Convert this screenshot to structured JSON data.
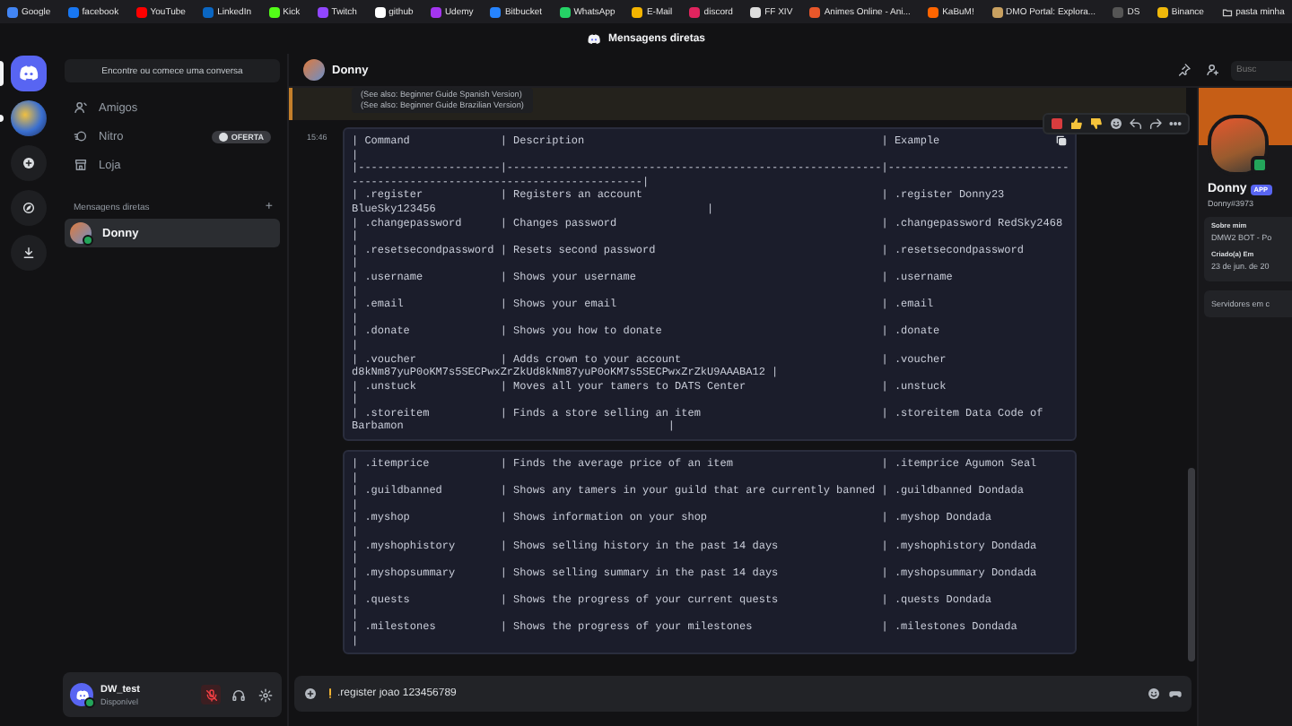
{
  "bookmarks": [
    {
      "kind": "site",
      "label": "Google",
      "color": "#4285f4"
    },
    {
      "kind": "site",
      "label": "facebook",
      "color": "#1877f2"
    },
    {
      "kind": "site",
      "label": "YouTube",
      "color": "#ff0000"
    },
    {
      "kind": "site",
      "label": "LinkedIn",
      "color": "#0a66c2"
    },
    {
      "kind": "site",
      "label": "Kick",
      "color": "#53fc18"
    },
    {
      "kind": "site",
      "label": "Twitch",
      "color": "#9146ff"
    },
    {
      "kind": "site",
      "label": "github",
      "color": "#ffffff"
    },
    {
      "kind": "site",
      "label": "Udemy",
      "color": "#a435f0"
    },
    {
      "kind": "site",
      "label": "Bitbucket",
      "color": "#2684ff"
    },
    {
      "kind": "site",
      "label": "WhatsApp",
      "color": "#25d366"
    },
    {
      "kind": "site",
      "label": "E-Mail",
      "color": "#f4b400"
    },
    {
      "kind": "site",
      "label": "discord",
      "color": "#e0245e"
    },
    {
      "kind": "site",
      "label": "FF XIV",
      "color": "#dddddd"
    },
    {
      "kind": "site",
      "label": "Animes Online - Ani...",
      "color": "#e8572a"
    },
    {
      "kind": "site",
      "label": "KaBuM!",
      "color": "#ff6500"
    },
    {
      "kind": "site",
      "label": "DMO Portal: Explora...",
      "color": "#c8a060"
    },
    {
      "kind": "site",
      "label": "DS",
      "color": "#555555"
    },
    {
      "kind": "site",
      "label": "Binance",
      "color": "#f0b90b"
    },
    {
      "kind": "folder",
      "label": "pasta minha",
      "color": "#cccccc"
    }
  ],
  "window": {
    "title": "Mensagens diretas"
  },
  "server_rail": [
    {
      "kind": "home",
      "selected": true
    },
    {
      "kind": "server",
      "selected": false,
      "unread": true
    },
    {
      "kind": "add",
      "selected": false
    },
    {
      "kind": "explore",
      "selected": false
    },
    {
      "kind": "download",
      "selected": false
    }
  ],
  "sidebar": {
    "search": {
      "placeholder": "Encontre ou comece uma conversa"
    },
    "nav": [
      {
        "kind": "friends",
        "label": "Amigos"
      },
      {
        "kind": "nitro",
        "label": "Nitro",
        "badge": "OFERTA"
      },
      {
        "kind": "shop",
        "label": "Loja"
      }
    ],
    "section_title": "Mensagens diretas",
    "add": "+",
    "dms": [
      {
        "name": "Donny",
        "selected": true
      }
    ]
  },
  "user_panel": {
    "name": "DW_test",
    "status": "Disponível",
    "muted": true
  },
  "chat": {
    "header": {
      "name": "Donny",
      "search": {
        "placeholder": "Busc"
      }
    },
    "quoted": [
      "(See also: Beginner Guide Spanish Version)",
      "(See also: Beginner Guide Brazilian Version)"
    ],
    "time": "15:46",
    "code_blocks": [
      [
        "| Command              | Description                                              | Example",
        "|",
        "|----------------------|----------------------------------------------------------|----------------------------",
        "---------------------------------------------|",
        "| .register            | Registers an account                                     | .register Donny23",
        "BlueSky123456                                          |",
        "| .changepassword      | Changes password                                         | .changepassword RedSky2468",
        "|",
        "| .resetsecondpassword | Resets second password                                   | .resetsecondpassword",
        "|",
        "| .username            | Shows your username                                      | .username",
        "|",
        "| .email               | Shows your email                                         | .email",
        "|",
        "| .donate              | Shows you how to donate                                  | .donate",
        "|",
        "| .voucher             | Adds crown to your account                               | .voucher",
        "d8kNm87yuP0oKM7s5SECPwxZrZkUd8kNm87yuP0oKM7s5SECPwxZrZkU9AAABA12 |",
        "| .unstuck             | Moves all your tamers to DATS Center                     | .unstuck",
        "|",
        "| .storeitem           | Finds a store selling an item                            | .storeitem Data Code of",
        "Barbamon                                         |"
      ],
      [
        "| .itemprice           | Finds the average price of an item                       | .itemprice Agumon Seal",
        "|",
        "| .guildbanned         | Shows any tamers in your guild that are currently banned | .guildbanned Dondada",
        "|",
        "| .myshop              | Shows information on your shop                           | .myshop Dondada",
        "|",
        "| .myshophistory       | Shows selling history in the past 14 days                | .myshophistory Dondada",
        "|",
        "| .myshopsummary       | Shows selling summary in the past 14 days                | .myshopsummary Dondada",
        "|",
        "| .quests              | Shows the progress of your current quests                | .quests Dondada",
        "|",
        "| .milestones          | Shows the progress of your milestones                    | .milestones Dondada",
        "|"
      ]
    ],
    "composer": {
      "value": ".register joao 123456789",
      "warning": true
    }
  },
  "profile": {
    "name": "Donny",
    "badge": "APP",
    "tag": "Donny#3973",
    "about_title": "Sobre mim",
    "about": "DMW2 BOT - Po",
    "created_title": "Criado(a) Em",
    "created": "23 de jun. de 20",
    "servers": "Servidores em c"
  }
}
